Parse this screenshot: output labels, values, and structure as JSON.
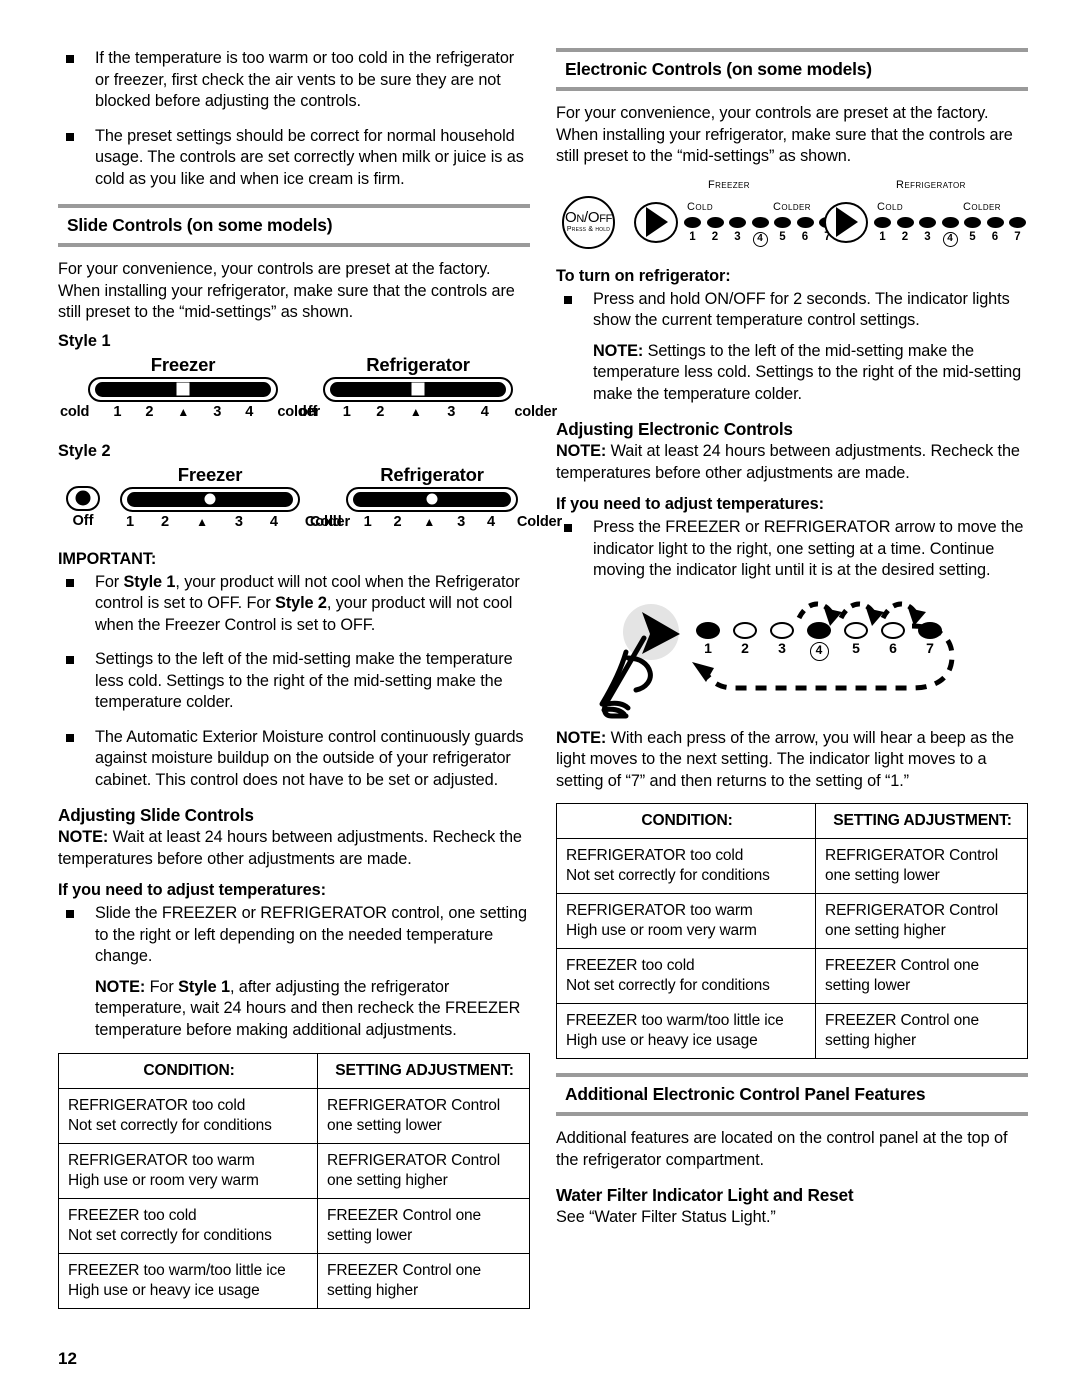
{
  "page": {
    "number": "12"
  },
  "left": {
    "intro_bullets": [
      "If the temperature is too warm or too cold in the refrigerator or freezer, first check the air vents to be sure they are not blocked before adjusting the controls.",
      "The preset settings should be correct for normal household usage. The controls are set correctly when milk or juice is as cold as you like and when ice cream is firm."
    ],
    "slide_section": {
      "heading": "Slide Controls (on some models)",
      "intro": "For your convenience, your controls are preset at the factory. When installing your refrigerator, make sure that the controls are still preset to the “mid-settings” as shown.",
      "style1_label": "Style 1",
      "style2_label": "Style 2",
      "style1": {
        "freezer": {
          "title": "Freezer",
          "scale_left": "cold",
          "ticks": [
            "1",
            "2",
            "▲",
            "3",
            "4"
          ],
          "scale_right": "colder"
        },
        "refrigerator": {
          "title": "Refrigerator",
          "scale_left": "off",
          "ticks": [
            "1",
            "2",
            "▲",
            "3",
            "4"
          ],
          "scale_right": "colder"
        }
      },
      "style2": {
        "off_label": "Off",
        "freezer": {
          "title": "Freezer",
          "ticks": [
            "1",
            "2",
            "▲",
            "3",
            "4"
          ],
          "scale_right": "Colder"
        },
        "refrigerator": {
          "title": "Refrigerator",
          "scale_left": "Cold",
          "ticks": [
            "1",
            "2",
            "▲",
            "3",
            "4"
          ],
          "scale_right": "Colder"
        }
      }
    },
    "important": {
      "label": "IMPORTANT:",
      "b1_pre": "For ",
      "b1_s1": "Style 1",
      "b1_mid": ", your product will not cool when the Refrigerator control is set to OFF. For ",
      "b1_s2": "Style 2",
      "b1_post": ", your product will not cool when the Freezer Control is set to OFF.",
      "b2": "Settings to the left of the mid-setting make the temperature less cold. Settings to the right of the mid-setting make the temperature colder.",
      "b3": "The Automatic Exterior Moisture control continuously guards against moisture buildup on the outside of your refrigerator cabinet. This control does not have to be set or adjusted."
    },
    "adjusting": {
      "heading": "Adjusting Slide Controls",
      "note_label": "NOTE:",
      "note_text": " Wait at least 24 hours between adjustments. Recheck the temperatures before other adjustments are made.",
      "if_label": "If you need to adjust temperatures:",
      "bullet": "Slide the FREEZER or REFRIGERATOR control, one setting to the right or left depending on the needed temperature change.",
      "subnote_label": "NOTE:",
      "subnote_pre": " For ",
      "subnote_style": "Style 1",
      "subnote_post": ", after adjusting the refrigerator temperature, wait 24 hours and then recheck the FREEZER temperature before making additional adjustments."
    },
    "table": {
      "headers": [
        "CONDITION:",
        "SETTING ADJUSTMENT:"
      ],
      "rows": [
        {
          "cond_l1": "REFRIGERATOR too cold",
          "cond_l2": "Not set correctly for conditions",
          "adj_l1": "REFRIGERATOR Control",
          "adj_l2": "one setting lower"
        },
        {
          "cond_l1": "REFRIGERATOR too warm",
          "cond_l2": "High use or room very warm",
          "adj_l1": "REFRIGERATOR Control",
          "adj_l2": "one setting higher"
        },
        {
          "cond_l1": "FREEZER too cold",
          "cond_l2": "Not set correctly for conditions",
          "adj_l1": "FREEZER Control one",
          "adj_l2": "setting lower"
        },
        {
          "cond_l1": "FREEZER too warm/too little ice",
          "cond_l2": "High use or heavy ice usage",
          "adj_l1": "FREEZER Control one",
          "adj_l2": "setting higher"
        }
      ]
    }
  },
  "right": {
    "electronic_section": {
      "heading": "Electronic Controls (on some models)",
      "intro": "For your convenience, your controls are preset at the factory. When installing your refrigerator, make sure that the controls are still preset to the “mid-settings” as shown."
    },
    "panel_diagram": {
      "onoff_line1": "On/Off",
      "onoff_line2": "Press & hold",
      "freezer_caption": "Freezer",
      "refrigerator_caption": "Refrigerator",
      "cold_label": "Cold",
      "colder_label": "Colder",
      "lamp_numbers": [
        "1",
        "2",
        "3",
        "4",
        "5",
        "6",
        "7"
      ],
      "mid_setting": "4"
    },
    "turn_on": {
      "heading": "To turn on refrigerator:",
      "bullet": "Press and hold ON/OFF for 2 seconds. The indicator lights show the current temperature control settings.",
      "note_label": "NOTE:",
      "note_text": " Settings to the left of the mid-setting make the temperature less cold. Settings to the right of the mid-setting make the temperature colder."
    },
    "adjusting": {
      "heading": "Adjusting Electronic Controls",
      "note_label": "NOTE:",
      "note_text": " Wait at least 24 hours between adjustments. Recheck the temperatures before other adjustments are made.",
      "if_label": "If you need to adjust temperatures:",
      "bullet": "Press the FREEZER or REFRIGERATOR arrow to move the indicator light to the right, one setting at a time. Continue moving the indicator light until it is at the desired setting."
    },
    "loop_diagram": {
      "lamp_numbers": [
        "1",
        "2",
        "3",
        "4",
        "5",
        "6",
        "7"
      ],
      "lit": [
        true,
        false,
        false,
        true,
        false,
        false,
        true
      ],
      "mid_setting": "4"
    },
    "beep_note": {
      "label": "NOTE:",
      "text": " With each press of the arrow, you will hear a beep as the light moves to the next setting. The indicator light moves to a setting of “7” and then returns to the setting of “1.”"
    },
    "table": {
      "headers": [
        "CONDITION:",
        "SETTING ADJUSTMENT:"
      ],
      "rows": [
        {
          "cond_l1": "REFRIGERATOR too cold",
          "cond_l2": "Not set correctly for conditions",
          "adj_l1": "REFRIGERATOR Control",
          "adj_l2": "one setting lower"
        },
        {
          "cond_l1": "REFRIGERATOR too warm",
          "cond_l2": "High use or room very warm",
          "adj_l1": "REFRIGERATOR Control",
          "adj_l2": "one setting higher"
        },
        {
          "cond_l1": "FREEZER too cold",
          "cond_l2": "Not set correctly for conditions",
          "adj_l1": "FREEZER Control one",
          "adj_l2": "setting lower"
        },
        {
          "cond_l1": "FREEZER too warm/too little ice",
          "cond_l2": "High use or heavy ice usage",
          "adj_l1": "FREEZER Control one",
          "adj_l2": "setting higher"
        }
      ]
    },
    "additional_section": {
      "heading": "Additional Electronic Control Panel Features",
      "body": "Additional features are located on the control panel at the top of the refrigerator compartment."
    },
    "water_filter": {
      "heading": "Water Filter Indicator Light and Reset",
      "body": "See “Water Filter Status Light.”"
    }
  }
}
